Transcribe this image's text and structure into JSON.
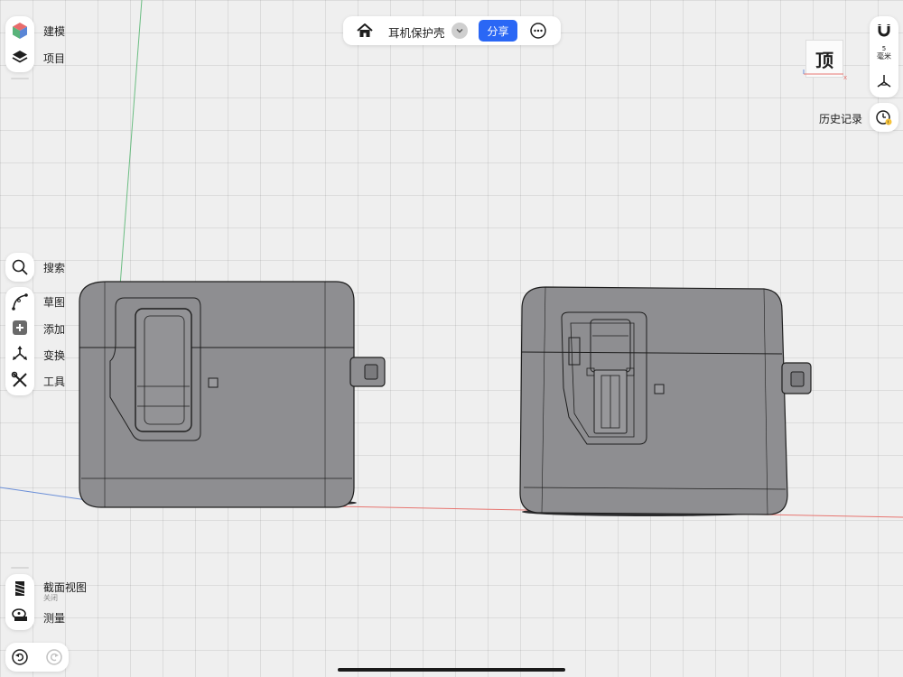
{
  "top_bar": {
    "project_name": "耳机保护壳",
    "share_label": "分享"
  },
  "left_top": {
    "items": [
      {
        "label": "建模"
      },
      {
        "label": "项目"
      }
    ]
  },
  "left_mid": {
    "items": [
      {
        "label": "搜索"
      },
      {
        "label": "草图"
      },
      {
        "label": "添加"
      },
      {
        "label": "变换"
      },
      {
        "label": "工具"
      }
    ]
  },
  "left_bottom": {
    "items": [
      {
        "label": "截面视图",
        "sub": "关闭"
      },
      {
        "label": "测量"
      }
    ]
  },
  "right_panel": {
    "units_value": "5",
    "units_label": "毫米",
    "history_label": "历史记录",
    "view_cube_label": "顶"
  },
  "colors": {
    "accent": "#2a67f5",
    "model_body": "#8e8e91",
    "x_axis": "#e77570",
    "y_axis": "#6bbd82",
    "z_axis": "#6b8fd8"
  }
}
